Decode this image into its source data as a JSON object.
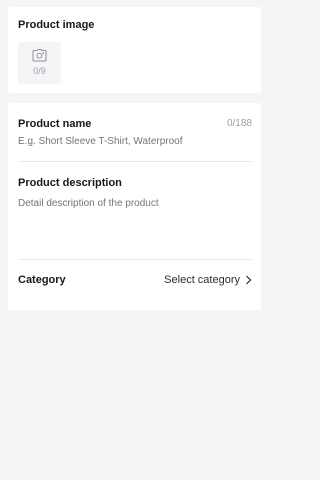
{
  "product_image": {
    "title": "Product image",
    "upload_count": "0/9",
    "upload_icon": "camera-plus-icon"
  },
  "product_name": {
    "label": "Product name",
    "counter": "0/188",
    "placeholder": "E.g. Short Sleeve T-Shirt, Waterproof",
    "value": ""
  },
  "product_description": {
    "label": "Product description",
    "placeholder": "Detail description of the product",
    "value": ""
  },
  "category": {
    "label": "Category",
    "selected": "Select category",
    "chevron_icon": "chevron-right-icon"
  }
}
